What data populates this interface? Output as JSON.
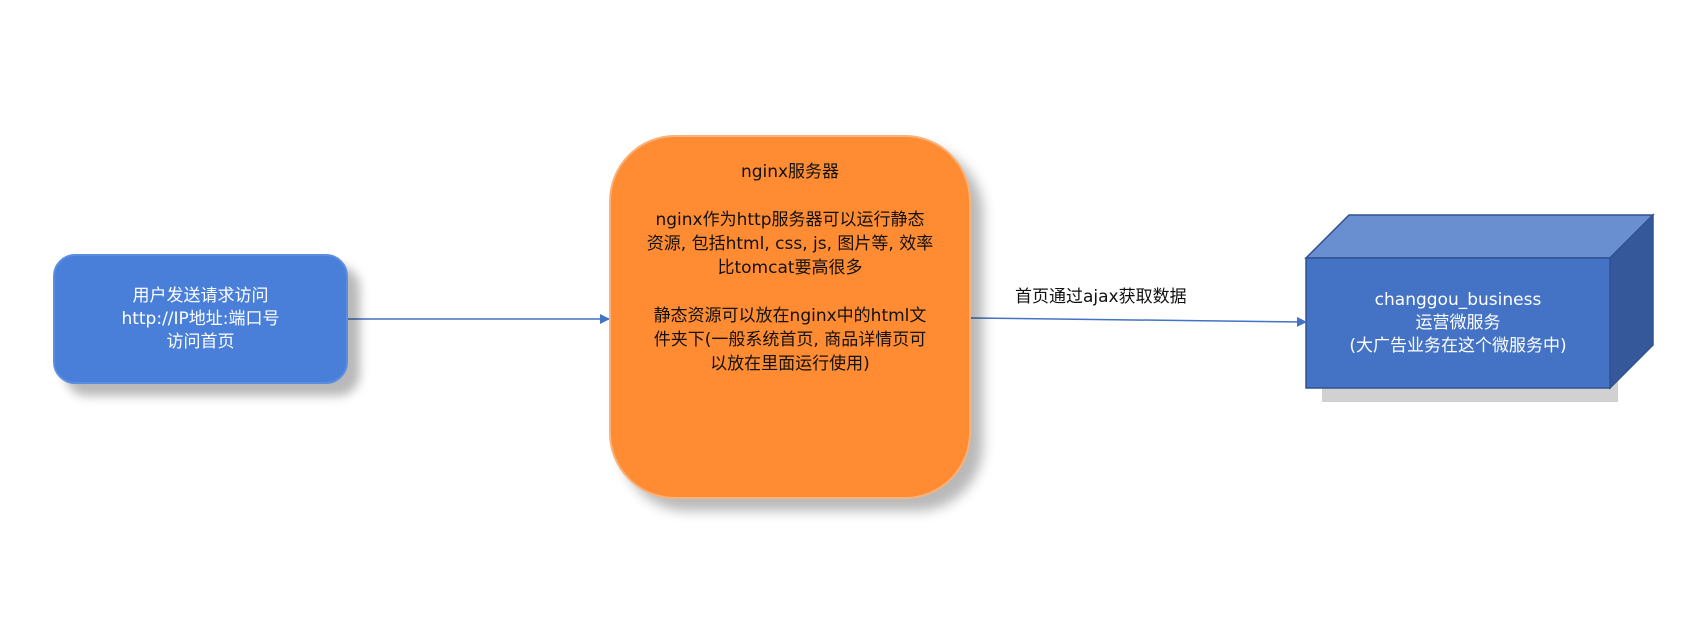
{
  "nodes": {
    "user": {
      "lines": [
        "用户发送请求访问",
        "http://IP地址:端口号",
        "访问首页"
      ]
    },
    "nginx": {
      "title": "nginx服务器",
      "para1": [
        "nginx作为http服务器可以运行静态",
        "资源, 包括html, css, js, 图片等, 效率",
        "比tomcat要高很多"
      ],
      "para2": [
        "静态资源可以放在nginx中的html文",
        "件夹下(一般系统首页, 商品详情页可",
        "以放在里面运行使用)"
      ]
    },
    "service": {
      "lines": [
        "changgou_business",
        "运营微服务",
        "(大广告业务在这个微服务中)"
      ]
    }
  },
  "edges": {
    "nginx_to_service": {
      "label": "首页通过ajax获取数据"
    }
  },
  "colors": {
    "user_fill": "#4a7fd9",
    "nginx_fill": "#ff8c33",
    "cube_front": "#4472c4",
    "cube_top": "#6a8fd0",
    "cube_side": "#34589a",
    "edge": "#4472c4"
  }
}
